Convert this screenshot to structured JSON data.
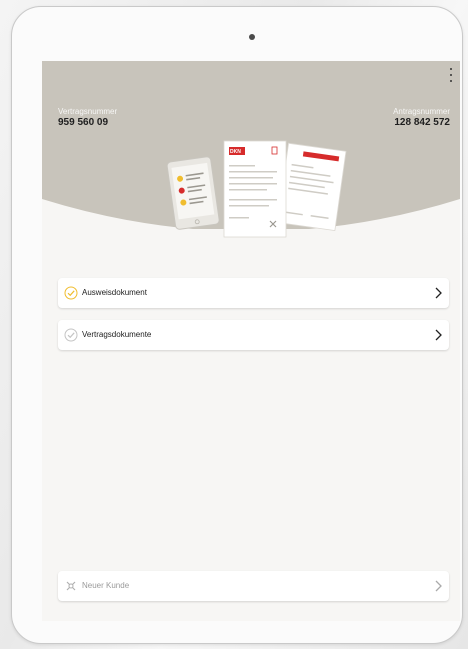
{
  "colors": {
    "header": "#c8c4bb",
    "accent_yellow": "#f0bd2e",
    "accent_red": "#d62b2b",
    "check_grey": "#c4c4c4"
  },
  "header": {
    "contract_label": "Vertragsnummer",
    "contract_number": "959 560 09",
    "application_label": "Antragsnummer",
    "application_number": "128 842 572"
  },
  "illustration": {
    "brand_text": "DKN"
  },
  "menu_icon": "more-vertical-icon",
  "documents": [
    {
      "label": "Ausweisdokument",
      "status_icon": "check-circle-yellow-icon",
      "chevron": "chevron-right-icon"
    },
    {
      "label": "Vertragsdokumente",
      "status_icon": "check-circle-grey-icon",
      "chevron": "chevron-right-icon"
    }
  ],
  "footer": {
    "new_customer_label": "Neuer Kunde",
    "icon": "new-customer-icon",
    "chevron": "chevron-right-icon"
  }
}
